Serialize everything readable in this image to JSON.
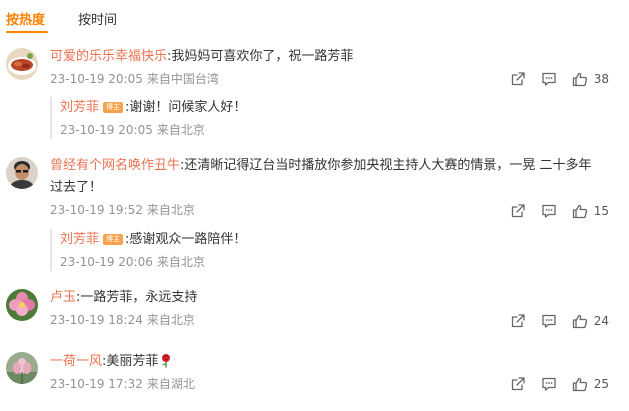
{
  "tabs": [
    {
      "label": "按热度",
      "active": true
    },
    {
      "label": "按时间",
      "active": false
    }
  ],
  "comments": [
    {
      "user": "可爱的乐乐幸福快乐",
      "text": ":我妈妈可喜欢你了，祝一路芳菲",
      "time": "23-10-19 20:05",
      "source": "来自中国台湾",
      "likes": "38",
      "avatar": "food-photo-avatar",
      "reply": {
        "user": "刘芳菲",
        "badge": "博主",
        "text": ":谢谢！问候家人好！",
        "time": "23-10-19 20:05",
        "source": "来自北京"
      }
    },
    {
      "user": "曾经有个网名唤作丑牛",
      "text_line1": ":还清晰记得辽台当时播放你参加央视主持人大赛的情景，一晃 二十多年",
      "text_line2": "过去了！",
      "time": "23-10-19 19:52",
      "source": "来自北京",
      "likes": "15",
      "avatar": "man-portrait-avatar",
      "reply": {
        "user": "刘芳菲",
        "badge": "博主",
        "text": ":感谢观众一路陪伴！",
        "time": "23-10-19 20:06",
        "source": "来自北京"
      }
    },
    {
      "user": "卢玉",
      "text": ":一路芳菲，永远支持",
      "time": "23-10-19 18:24",
      "source": "来自北京",
      "likes": "24",
      "avatar": "pink-flower-avatar"
    },
    {
      "user": "一荷一风",
      "text": ":美丽芳菲",
      "emoji": "rose-emoji",
      "time": "23-10-19 17:32",
      "source": "来自湖北",
      "likes": "25",
      "avatar": "lotus-avatar"
    }
  ],
  "colors": {
    "accent": "#ff8200",
    "username": "#eb7350",
    "meta": "#939393",
    "badge": "#f7a24e"
  },
  "icons": [
    "share-icon",
    "comment-icon",
    "like-icon"
  ]
}
